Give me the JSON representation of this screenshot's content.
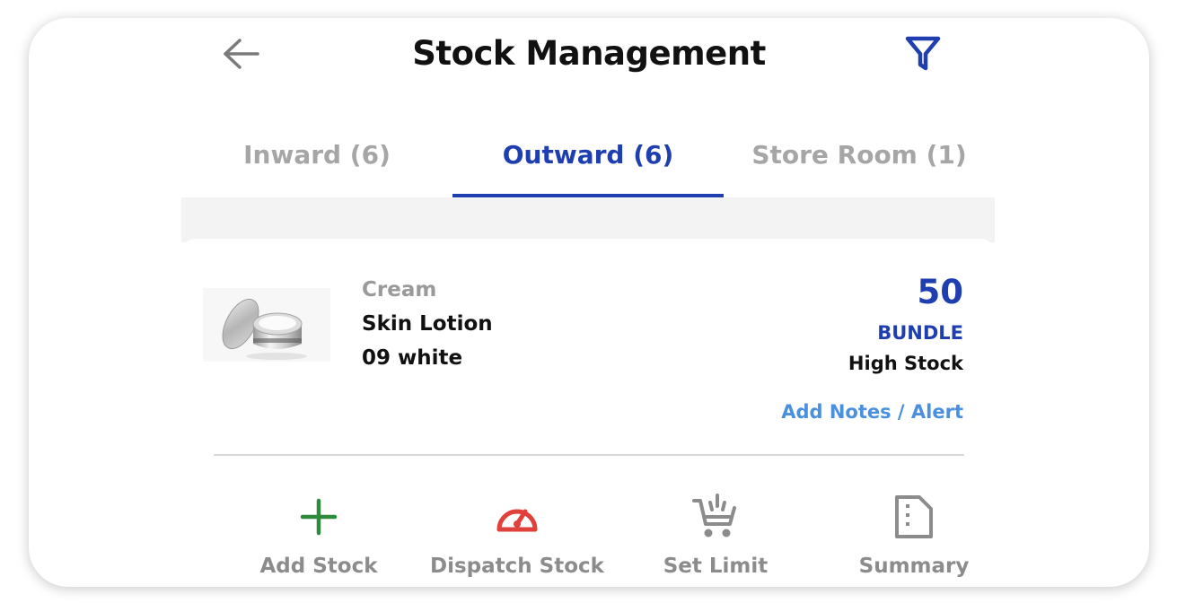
{
  "header": {
    "title": "Stock Management",
    "back_icon": "arrow-left-icon",
    "filter_icon": "filter-icon"
  },
  "tabs": [
    {
      "label": "Inward (6)",
      "active": false
    },
    {
      "label": "Outward (6)",
      "active": true
    },
    {
      "label": "Store Room (1)",
      "active": false
    }
  ],
  "item": {
    "category": "Cream",
    "name": "Skin Lotion",
    "variant": "09 white",
    "quantity": "50",
    "unit": "BUNDLE",
    "stock_status": "High Stock",
    "notes_link": "Add Notes / Alert"
  },
  "actions": [
    {
      "label": "Add Stock",
      "icon": "plus-icon",
      "color": "#2e8b3e"
    },
    {
      "label": "Dispatch Stock",
      "icon": "speedometer-icon",
      "color": "#e0413a"
    },
    {
      "label": "Set Limit",
      "icon": "cart-icon",
      "color": "#8c8c8c"
    },
    {
      "label": "Summary",
      "icon": "document-icon",
      "color": "#8c8c8c"
    }
  ],
  "colors": {
    "accent": "#1f3fb0",
    "link": "#4a8fe0",
    "inactive_tab": "#a6a6a6"
  }
}
